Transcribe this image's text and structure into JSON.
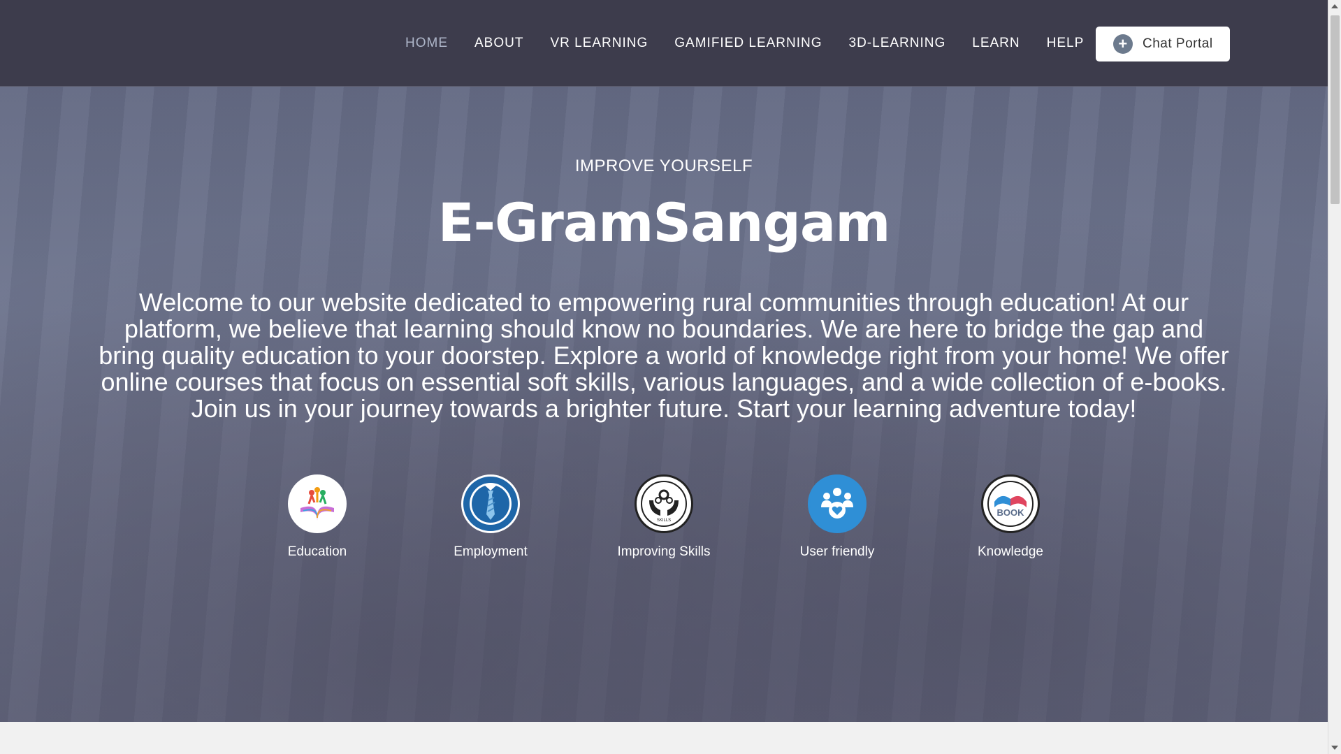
{
  "nav": {
    "items": [
      {
        "label": "HOME",
        "active": true
      },
      {
        "label": "ABOUT",
        "active": false
      },
      {
        "label": "VR LEARNING",
        "active": false
      },
      {
        "label": "GAMIFIED LEARNING",
        "active": false
      },
      {
        "label": "3D-LEARNING",
        "active": false
      },
      {
        "label": "LEARN",
        "active": false
      },
      {
        "label": "HELP",
        "active": false
      }
    ],
    "chat_button": "Chat Portal"
  },
  "hero": {
    "eyebrow": "IMPROVE YOURSELF",
    "title": "E-GramSangam",
    "intro": "Welcome to our website dedicated to empowering rural communities through education! At our platform, we believe that learning should know no boundaries. We are here to bridge the gap and bring quality education to your doorstep. Explore a world of knowledge right from your home! We offer online courses that focus on essential soft skills, various languages, and a wide collection of e-books. Join us in your journey towards a brighter future. Start your learning adventure today!"
  },
  "features": [
    {
      "label": "Education",
      "icon": "education-icon"
    },
    {
      "label": "Employment",
      "icon": "tie-icon"
    },
    {
      "label": "Improving Skills",
      "icon": "skills-icon",
      "icon_text": "SKILLS"
    },
    {
      "label": "User friendly",
      "icon": "users-heart-icon"
    },
    {
      "label": "Knowledge",
      "icon": "book-icon",
      "icon_text": "BOOK"
    }
  ],
  "colors": {
    "navbar": "#3d3c4c",
    "nav_active": "#aeb6c9",
    "user_friendly_icon": "#2f8fd6",
    "employment_icon": "#1e66a8"
  }
}
